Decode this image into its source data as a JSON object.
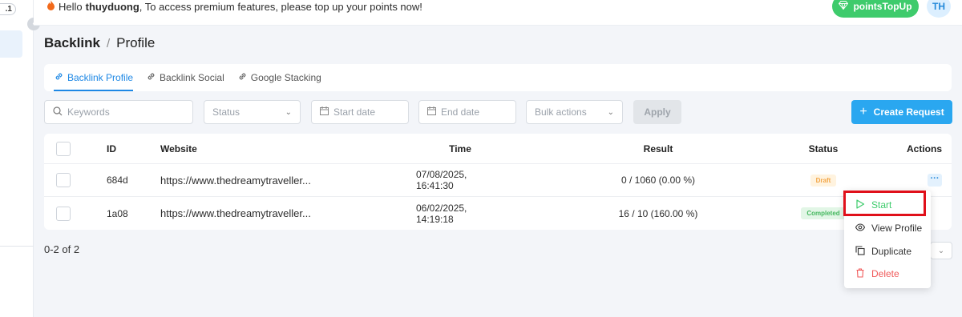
{
  "sidebar": {
    "version_badge": ".1"
  },
  "topbar": {
    "greeting_prefix": "Hello",
    "username": "thuyduong",
    "greeting_suffix": ", To access premium features, please top up your points now!",
    "topup_label": "pointsTopUp",
    "avatar_initials": "TH"
  },
  "breadcrumb": {
    "root": "Backlink",
    "separator": "/",
    "current": "Profile"
  },
  "tabs": [
    {
      "label": "Backlink Profile",
      "active": true
    },
    {
      "label": "Backlink Social",
      "active": false
    },
    {
      "label": "Google Stacking",
      "active": false
    }
  ],
  "filters": {
    "keywords_placeholder": "Keywords",
    "status_placeholder": "Status",
    "start_date_placeholder": "Start date",
    "end_date_placeholder": "End date",
    "bulk_actions_placeholder": "Bulk actions",
    "apply_label": "Apply",
    "create_label": "Create Request"
  },
  "table": {
    "headers": {
      "id": "ID",
      "website": "Website",
      "time": "Time",
      "result": "Result",
      "status": "Status",
      "actions": "Actions"
    },
    "rows": [
      {
        "id": "684d",
        "website": "https://www.thedreamytraveller...",
        "time": "07/08/2025, 16:41:30",
        "result": "0 / 1060 (0.00 %)",
        "status": "Draft"
      },
      {
        "id": "1a08",
        "website": "https://www.thedreamytraveller...",
        "time": "06/02/2025, 14:19:18",
        "result": "16 / 10 (160.00 %)",
        "status": "Completed"
      }
    ]
  },
  "pagination": {
    "info": "0-2 of 2"
  },
  "action_menu": {
    "items": [
      {
        "label": "Start",
        "icon": "play-icon"
      },
      {
        "label": "View Profile",
        "icon": "eye-icon"
      },
      {
        "label": "Duplicate",
        "icon": "copy-icon"
      },
      {
        "label": "Delete",
        "icon": "trash-icon"
      }
    ]
  },
  "colors": {
    "accent": "#1e88e5",
    "create_button": "#2aa7f0",
    "success": "#3ecb6c",
    "danger": "#f05a5a",
    "highlight": "#e0101a"
  }
}
